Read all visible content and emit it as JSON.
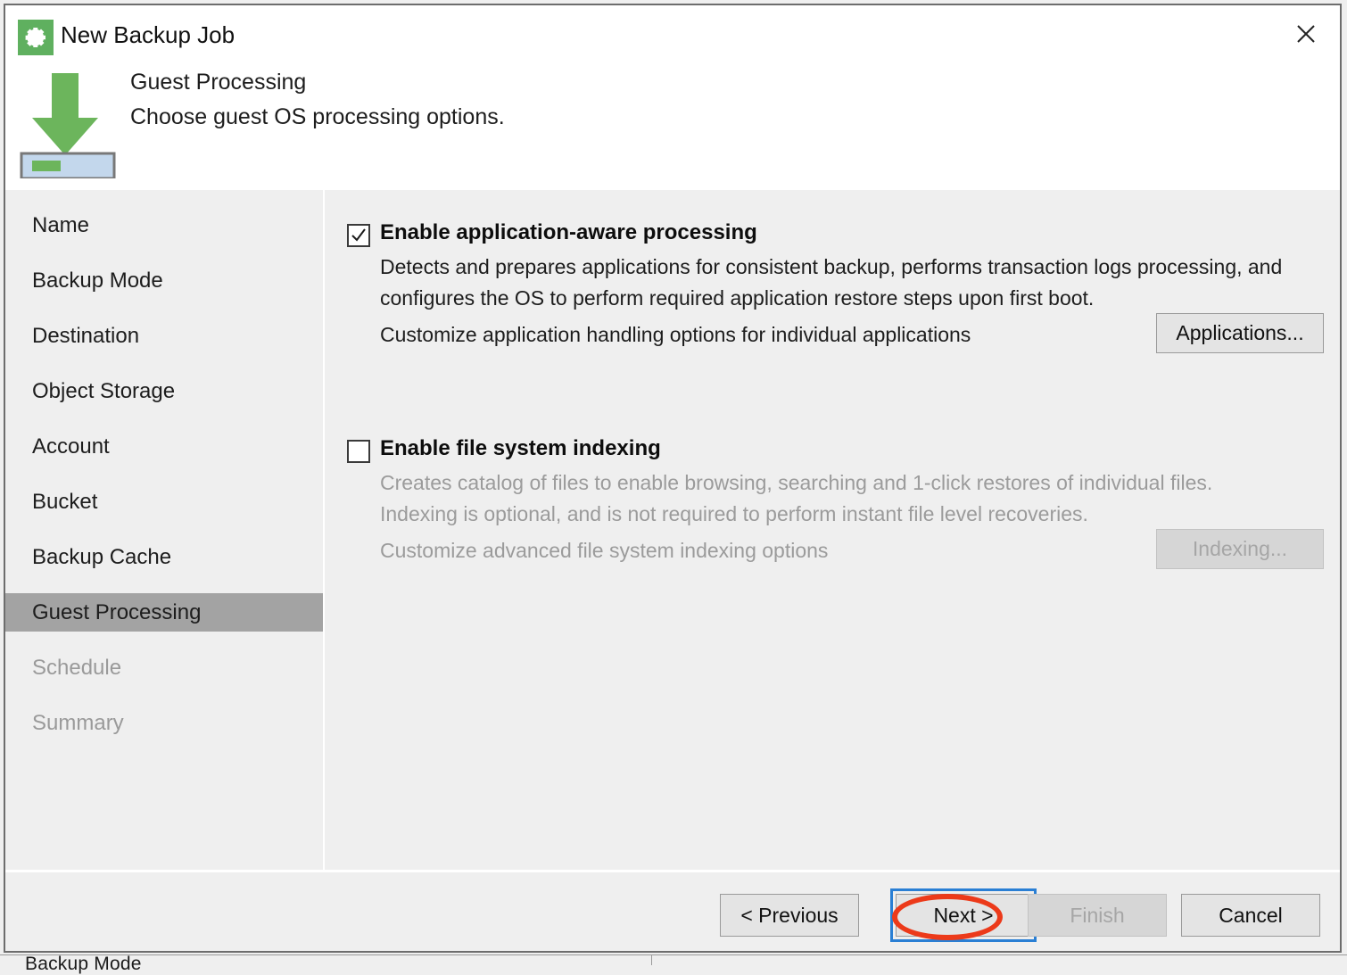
{
  "window": {
    "title": "New Backup Job",
    "icon": "gear-icon",
    "close_label": "✕"
  },
  "header": {
    "step_title": "Guest Processing",
    "step_subtitle": "Choose guest OS processing options.",
    "icon": "download-arrow-to-storage-icon"
  },
  "sidebar": {
    "items": [
      {
        "label": "Name",
        "state": "normal"
      },
      {
        "label": "Backup Mode",
        "state": "normal"
      },
      {
        "label": "Destination",
        "state": "normal"
      },
      {
        "label": "Object Storage",
        "state": "normal"
      },
      {
        "label": "Account",
        "state": "normal"
      },
      {
        "label": "Bucket",
        "state": "normal"
      },
      {
        "label": "Backup Cache",
        "state": "normal"
      },
      {
        "label": "Guest Processing",
        "state": "active"
      },
      {
        "label": "Schedule",
        "state": "disabled"
      },
      {
        "label": "Summary",
        "state": "disabled"
      }
    ]
  },
  "main": {
    "app_aware": {
      "checkbox_label": "Enable application-aware processing",
      "checked": true,
      "description_line1": "Detects and prepares applications for consistent backup, performs transaction logs processing, and",
      "description_line2": "configures the OS to perform required application restore steps upon first boot.",
      "customize_text": "Customize application handling options for individual applications",
      "button_label": "Applications...",
      "button_enabled": true
    },
    "indexing": {
      "checkbox_label": "Enable file system indexing",
      "checked": false,
      "description_line1": "Creates catalog of files to enable browsing, searching and 1-click restores of individual files.",
      "description_line2": "Indexing is optional, and is not required to perform instant file level recoveries.",
      "customize_text": "Customize advanced file system indexing options",
      "button_label": "Indexing...",
      "button_enabled": false
    }
  },
  "footer": {
    "previous_label": "< Previous",
    "next_label": "Next >",
    "finish_label": "Finish",
    "cancel_label": "Cancel",
    "finish_enabled": false,
    "focused_button": "Next >"
  },
  "annotation": {
    "type": "ellipse-highlight",
    "target": "Next >",
    "color": "#ec3a1a"
  },
  "background": {
    "text_fragment": "Backup Mode",
    "text_fragment2": "..."
  },
  "colors": {
    "accent_green": "#5fb05f",
    "active_nav": "#a3a3a3",
    "focus_blue": "#2a7fd4",
    "annotation_red": "#ec3a1a",
    "dialog_bg": "#efefef",
    "header_bg": "#ffffff"
  }
}
